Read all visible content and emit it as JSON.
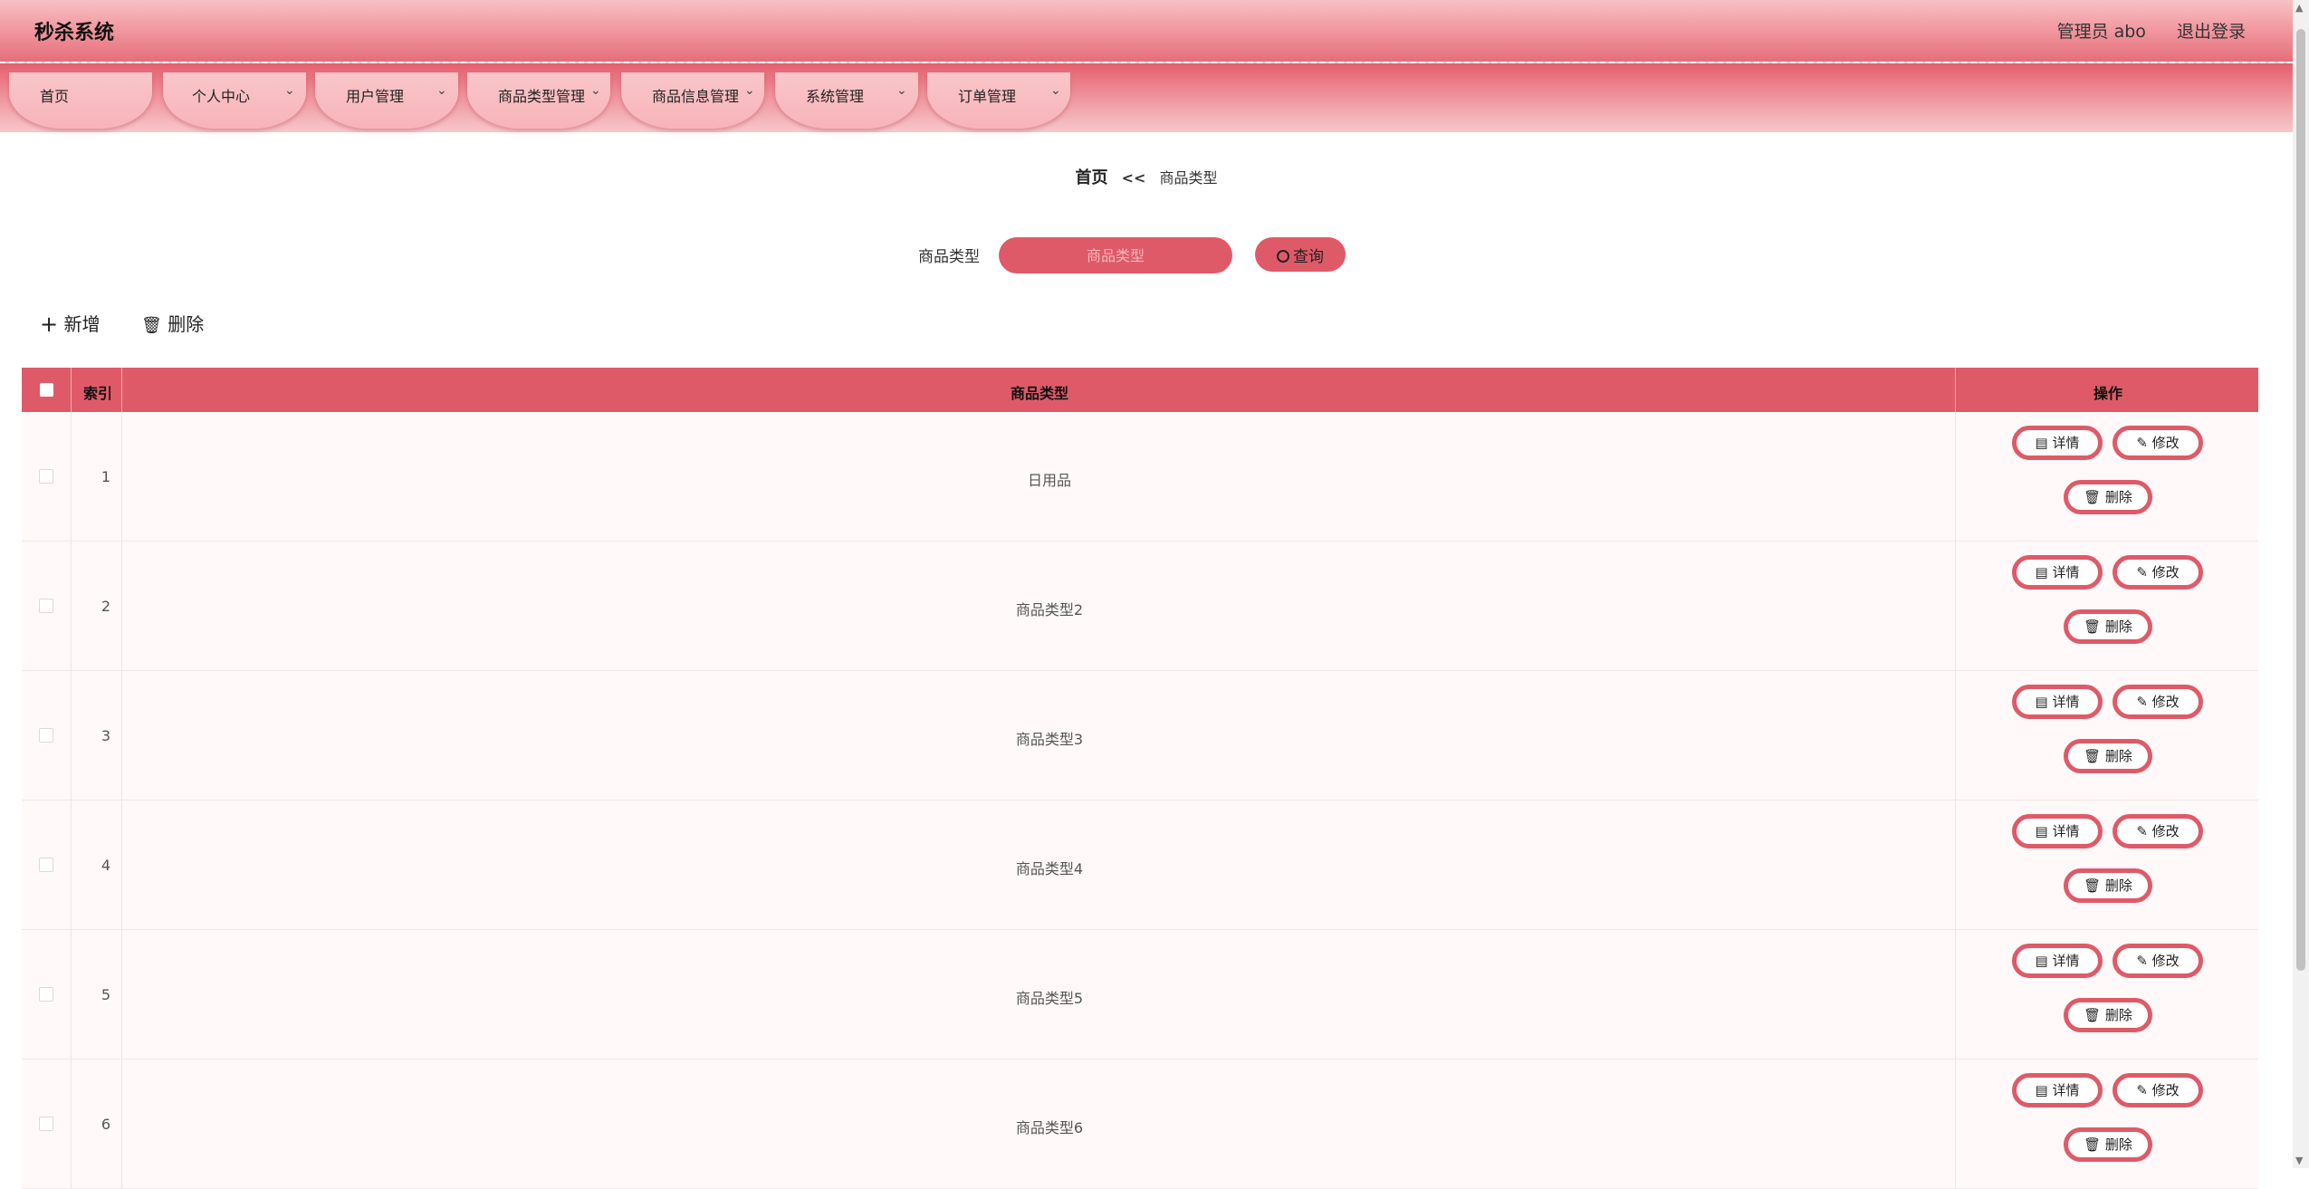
{
  "header": {
    "title": "秒杀系统",
    "user_label": "管理员 abo",
    "logout_label": "退出登录"
  },
  "nav": {
    "items": [
      {
        "label": "首页",
        "has_dropdown": false
      },
      {
        "label": "个人中心",
        "has_dropdown": true
      },
      {
        "label": "用户管理",
        "has_dropdown": true
      },
      {
        "label": "商品类型管理",
        "has_dropdown": true
      },
      {
        "label": "商品信息管理",
        "has_dropdown": true
      },
      {
        "label": "系统管理",
        "has_dropdown": true
      },
      {
        "label": "订单管理",
        "has_dropdown": true
      }
    ]
  },
  "breadcrumb": {
    "home": "首页",
    "separator": "<<",
    "current": "商品类型"
  },
  "search": {
    "label": "商品类型",
    "placeholder": "商品类型",
    "button_label": "查询"
  },
  "toolbar": {
    "add_label": "新增",
    "delete_label": "删除"
  },
  "table": {
    "columns": {
      "index": "索引",
      "type": "商品类型",
      "actions": "操作"
    },
    "action_labels": {
      "detail": "详情",
      "edit": "修改",
      "delete": "删除"
    },
    "rows": [
      {
        "index": "1",
        "type": "日用品"
      },
      {
        "index": "2",
        "type": "商品类型2"
      },
      {
        "index": "3",
        "type": "商品类型3"
      },
      {
        "index": "4",
        "type": "商品类型4"
      },
      {
        "index": "5",
        "type": "商品类型5"
      },
      {
        "index": "6",
        "type": "商品类型6"
      }
    ]
  },
  "colors": {
    "accent": "#df5a68",
    "header_light": "#f7c1c4",
    "row_bg": "#fff9f9"
  },
  "icons": {
    "search": "search-icon",
    "add": "plus-icon",
    "delete": "trash-icon",
    "detail": "document-icon",
    "edit": "pencil-icon",
    "dropdown": "chevron-down-icon"
  }
}
